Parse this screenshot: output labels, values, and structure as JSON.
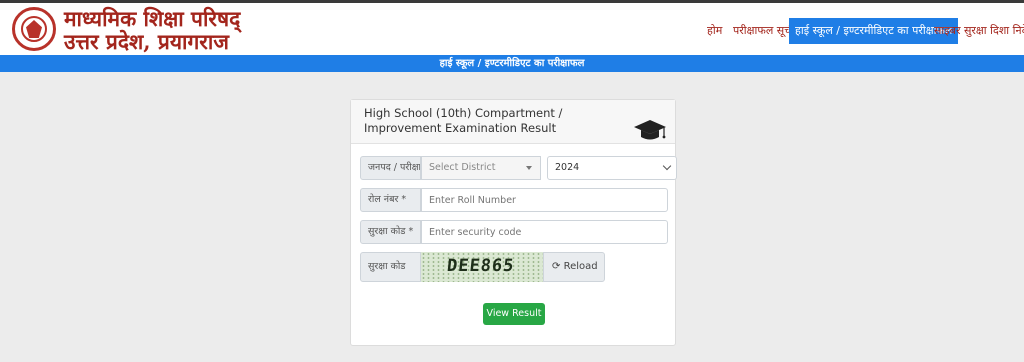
{
  "header": {
    "title_line1": "माध्यमिक शिक्षा परिषद्",
    "title_line2": "उत्तर प्रदेश, प्रयागराज",
    "nav": [
      "होम",
      "परीक्षाफल सूची",
      "हाई स्कूल / इण्टरमीडिएट का परीक्षाफल",
      "साइबर सुरक्षा दिशा निर्देश"
    ]
  },
  "banner": "हाई स्कूल / इण्टरमीडिएट का परीक्षाफल",
  "form": {
    "title": "High School (10th) Compartment / Improvement Examination Result",
    "district_label": "जनपद / परीक्षा",
    "district_placeholder": "Select District",
    "year_value": "2024",
    "roll_label": "रोल नंबर *",
    "roll_placeholder": "Enter Roll Number",
    "security_label": "सुरक्षा कोड *",
    "security_placeholder": "Enter security code",
    "captcha_label": "सुरक्षा कोड",
    "captcha_text": "DEE865",
    "reload_label": "Reload",
    "submit_label": "View Result"
  },
  "colors": {
    "brand_red": "#a3251c",
    "accent_blue": "#1f7ee6",
    "button_green": "#28a745"
  }
}
